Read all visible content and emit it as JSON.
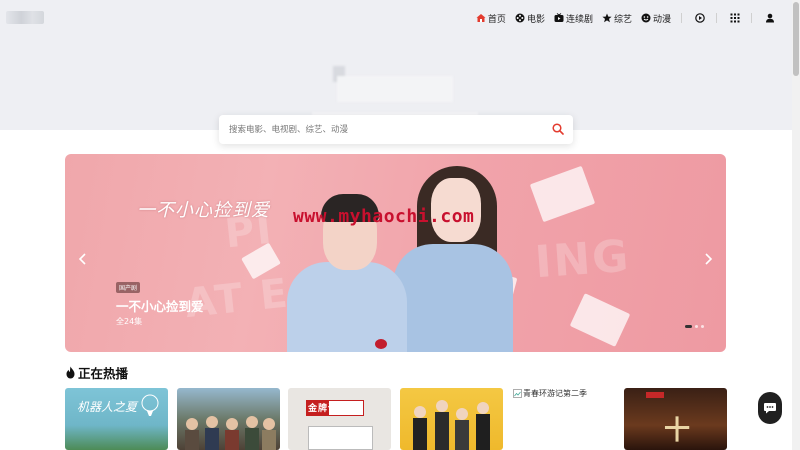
{
  "header": {
    "nav": [
      {
        "label": "首页",
        "icon": "home-icon",
        "active": true
      },
      {
        "label": "电影",
        "icon": "film-reel-icon"
      },
      {
        "label": "连续剧",
        "icon": "tv-icon"
      },
      {
        "label": "综艺",
        "icon": "star-icon"
      },
      {
        "label": "动漫",
        "icon": "smile-icon"
      }
    ],
    "buttons": [
      {
        "icon": "play-history-icon"
      },
      {
        "icon": "grid-menu-icon"
      },
      {
        "icon": "user-icon"
      }
    ],
    "accent_color": "#e33b2e"
  },
  "search": {
    "placeholder": "搜索电影、电视剧、综艺、动漫",
    "button_icon": "search-icon"
  },
  "banner": {
    "art_title": "一不小心捡到爱",
    "watermark": "www.myhaochi.com",
    "tag": "国产剧",
    "title": "一不小心捡到爱",
    "episodes": "全24集",
    "slide_count": 3,
    "active_slide": 0
  },
  "hot": {
    "title": "正在热播",
    "icon": "flame-icon",
    "cards": [
      {
        "art": "机器人之夏"
      },
      {},
      {
        "logo": "金牌调解"
      },
      {},
      {
        "broken_label": "青春环游记第二季"
      },
      {
        "art": "十"
      }
    ]
  },
  "float": {
    "icon": "chat-icon"
  }
}
